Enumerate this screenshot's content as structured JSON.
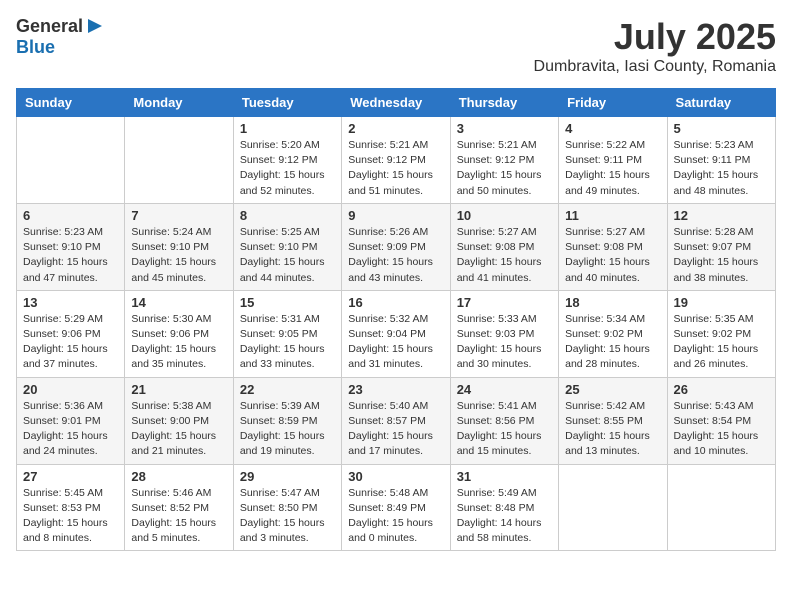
{
  "header": {
    "logo_general": "General",
    "logo_blue": "Blue",
    "month_year": "July 2025",
    "location": "Dumbravita, Iasi County, Romania"
  },
  "weekdays": [
    "Sunday",
    "Monday",
    "Tuesday",
    "Wednesday",
    "Thursday",
    "Friday",
    "Saturday"
  ],
  "weeks": [
    [
      {
        "day": "",
        "detail": ""
      },
      {
        "day": "",
        "detail": ""
      },
      {
        "day": "1",
        "detail": "Sunrise: 5:20 AM\nSunset: 9:12 PM\nDaylight: 15 hours and 52 minutes."
      },
      {
        "day": "2",
        "detail": "Sunrise: 5:21 AM\nSunset: 9:12 PM\nDaylight: 15 hours and 51 minutes."
      },
      {
        "day": "3",
        "detail": "Sunrise: 5:21 AM\nSunset: 9:12 PM\nDaylight: 15 hours and 50 minutes."
      },
      {
        "day": "4",
        "detail": "Sunrise: 5:22 AM\nSunset: 9:11 PM\nDaylight: 15 hours and 49 minutes."
      },
      {
        "day": "5",
        "detail": "Sunrise: 5:23 AM\nSunset: 9:11 PM\nDaylight: 15 hours and 48 minutes."
      }
    ],
    [
      {
        "day": "6",
        "detail": "Sunrise: 5:23 AM\nSunset: 9:10 PM\nDaylight: 15 hours and 47 minutes."
      },
      {
        "day": "7",
        "detail": "Sunrise: 5:24 AM\nSunset: 9:10 PM\nDaylight: 15 hours and 45 minutes."
      },
      {
        "day": "8",
        "detail": "Sunrise: 5:25 AM\nSunset: 9:10 PM\nDaylight: 15 hours and 44 minutes."
      },
      {
        "day": "9",
        "detail": "Sunrise: 5:26 AM\nSunset: 9:09 PM\nDaylight: 15 hours and 43 minutes."
      },
      {
        "day": "10",
        "detail": "Sunrise: 5:27 AM\nSunset: 9:08 PM\nDaylight: 15 hours and 41 minutes."
      },
      {
        "day": "11",
        "detail": "Sunrise: 5:27 AM\nSunset: 9:08 PM\nDaylight: 15 hours and 40 minutes."
      },
      {
        "day": "12",
        "detail": "Sunrise: 5:28 AM\nSunset: 9:07 PM\nDaylight: 15 hours and 38 minutes."
      }
    ],
    [
      {
        "day": "13",
        "detail": "Sunrise: 5:29 AM\nSunset: 9:06 PM\nDaylight: 15 hours and 37 minutes."
      },
      {
        "day": "14",
        "detail": "Sunrise: 5:30 AM\nSunset: 9:06 PM\nDaylight: 15 hours and 35 minutes."
      },
      {
        "day": "15",
        "detail": "Sunrise: 5:31 AM\nSunset: 9:05 PM\nDaylight: 15 hours and 33 minutes."
      },
      {
        "day": "16",
        "detail": "Sunrise: 5:32 AM\nSunset: 9:04 PM\nDaylight: 15 hours and 31 minutes."
      },
      {
        "day": "17",
        "detail": "Sunrise: 5:33 AM\nSunset: 9:03 PM\nDaylight: 15 hours and 30 minutes."
      },
      {
        "day": "18",
        "detail": "Sunrise: 5:34 AM\nSunset: 9:02 PM\nDaylight: 15 hours and 28 minutes."
      },
      {
        "day": "19",
        "detail": "Sunrise: 5:35 AM\nSunset: 9:02 PM\nDaylight: 15 hours and 26 minutes."
      }
    ],
    [
      {
        "day": "20",
        "detail": "Sunrise: 5:36 AM\nSunset: 9:01 PM\nDaylight: 15 hours and 24 minutes."
      },
      {
        "day": "21",
        "detail": "Sunrise: 5:38 AM\nSunset: 9:00 PM\nDaylight: 15 hours and 21 minutes."
      },
      {
        "day": "22",
        "detail": "Sunrise: 5:39 AM\nSunset: 8:59 PM\nDaylight: 15 hours and 19 minutes."
      },
      {
        "day": "23",
        "detail": "Sunrise: 5:40 AM\nSunset: 8:57 PM\nDaylight: 15 hours and 17 minutes."
      },
      {
        "day": "24",
        "detail": "Sunrise: 5:41 AM\nSunset: 8:56 PM\nDaylight: 15 hours and 15 minutes."
      },
      {
        "day": "25",
        "detail": "Sunrise: 5:42 AM\nSunset: 8:55 PM\nDaylight: 15 hours and 13 minutes."
      },
      {
        "day": "26",
        "detail": "Sunrise: 5:43 AM\nSunset: 8:54 PM\nDaylight: 15 hours and 10 minutes."
      }
    ],
    [
      {
        "day": "27",
        "detail": "Sunrise: 5:45 AM\nSunset: 8:53 PM\nDaylight: 15 hours and 8 minutes."
      },
      {
        "day": "28",
        "detail": "Sunrise: 5:46 AM\nSunset: 8:52 PM\nDaylight: 15 hours and 5 minutes."
      },
      {
        "day": "29",
        "detail": "Sunrise: 5:47 AM\nSunset: 8:50 PM\nDaylight: 15 hours and 3 minutes."
      },
      {
        "day": "30",
        "detail": "Sunrise: 5:48 AM\nSunset: 8:49 PM\nDaylight: 15 hours and 0 minutes."
      },
      {
        "day": "31",
        "detail": "Sunrise: 5:49 AM\nSunset: 8:48 PM\nDaylight: 14 hours and 58 minutes."
      },
      {
        "day": "",
        "detail": ""
      },
      {
        "day": "",
        "detail": ""
      }
    ]
  ]
}
